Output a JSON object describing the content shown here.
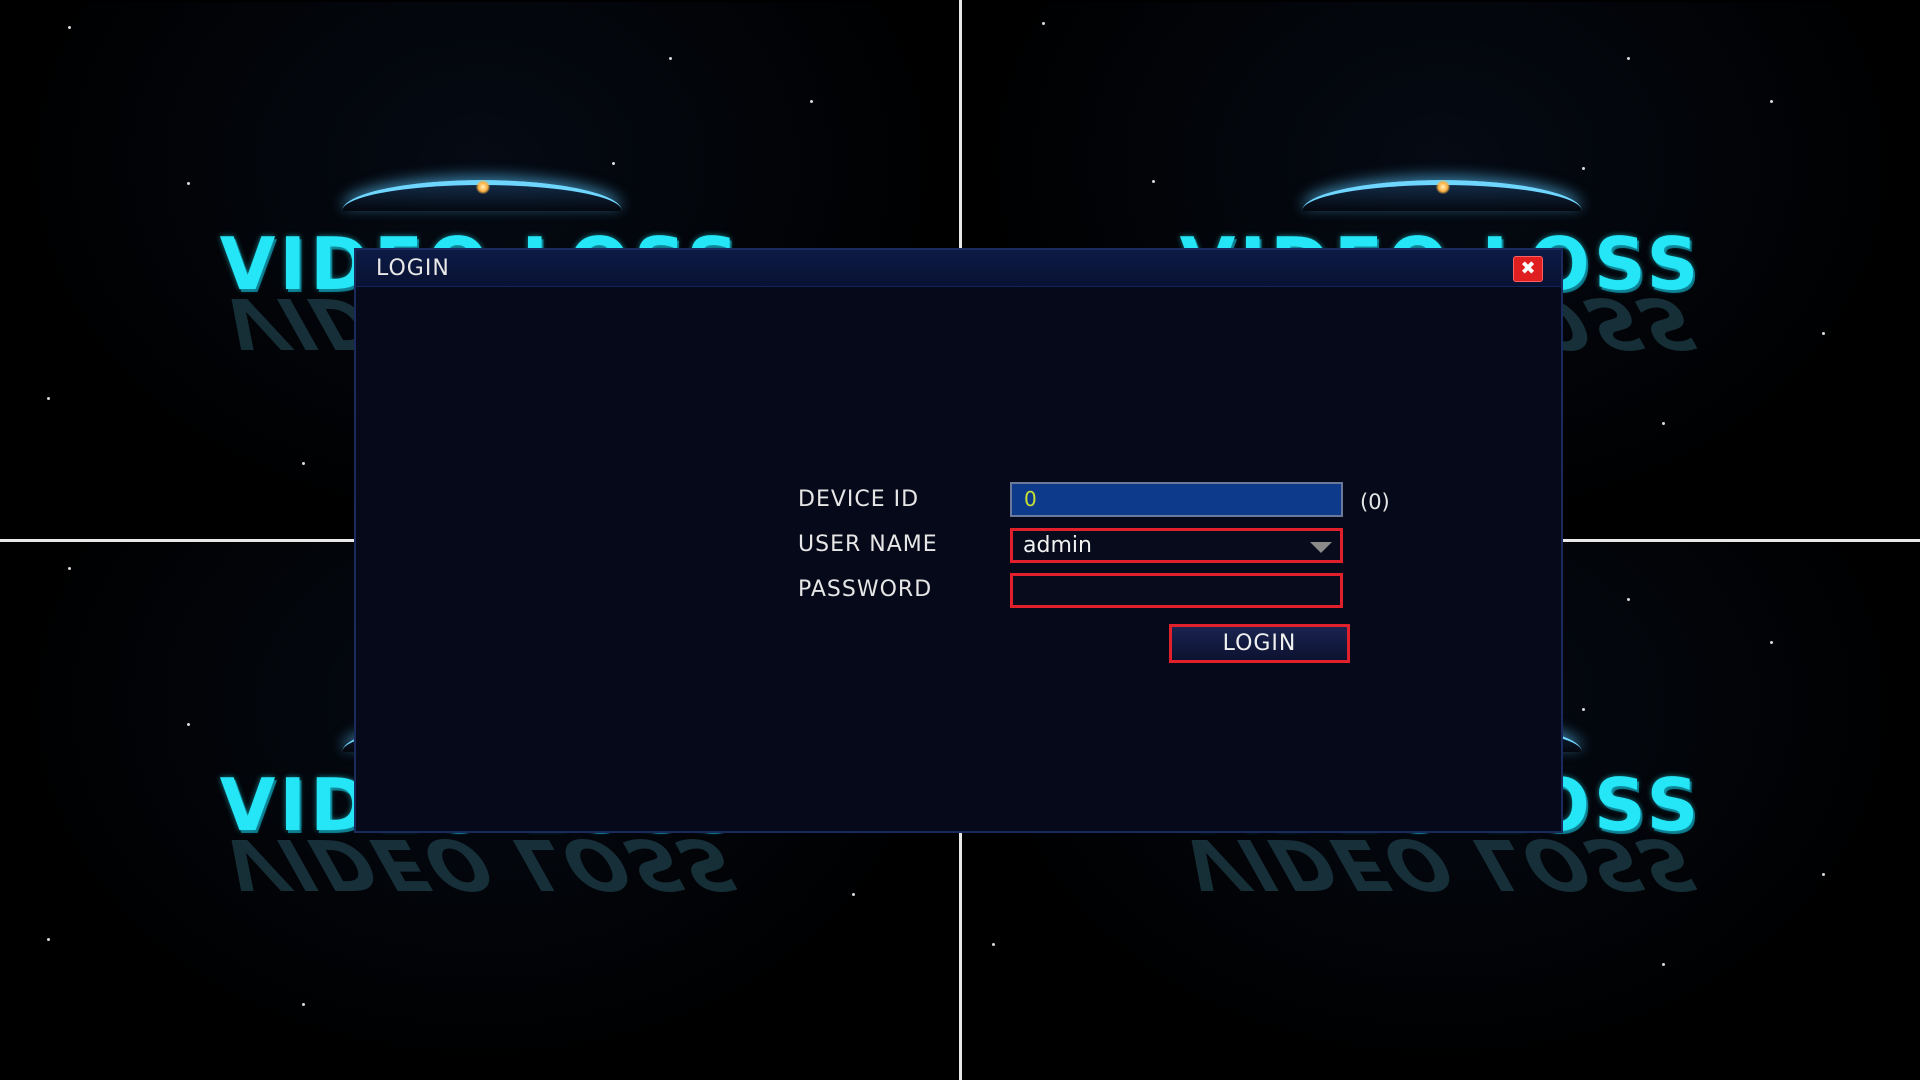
{
  "camera_tiles": [
    {
      "overlay_text": "VIDEO LOSS"
    },
    {
      "overlay_text": "VIDEO LOSS"
    },
    {
      "overlay_text": "VIDEO LOSS"
    },
    {
      "overlay_text": "VIDEO LOSS"
    }
  ],
  "dialog": {
    "title": "LOGIN",
    "close_icon": "close-icon",
    "close_glyph": "✖"
  },
  "form": {
    "device_id_label": "DEVICE ID",
    "device_id_value": "0",
    "device_id_hint": "(0)",
    "username_label": "USER NAME",
    "username_value": "admin",
    "password_label": "PASSWORD",
    "password_value": "",
    "login_button": "LOGIN"
  },
  "colors": {
    "accent": "#e0202a",
    "dialog_bg": "#06091a",
    "device_id_bg": "#0d3a8a",
    "video_loss_text": "#24e6f6"
  }
}
